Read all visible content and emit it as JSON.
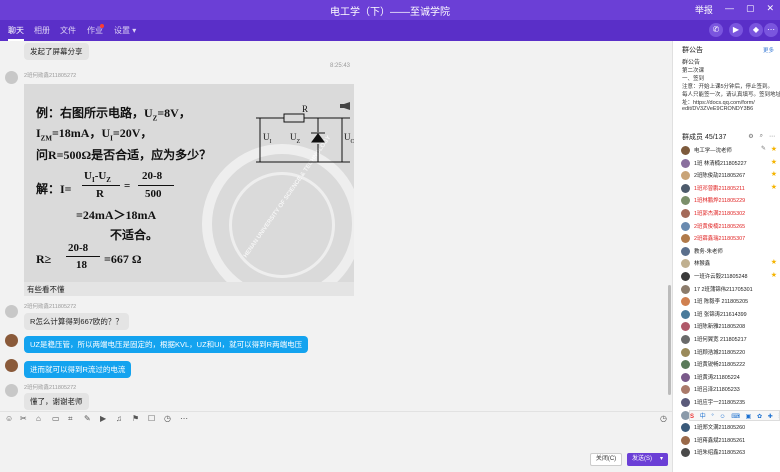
{
  "window": {
    "title": "电工学（下）——至诚学院",
    "controls": [
      "举报",
      "—",
      "▢",
      "✕"
    ]
  },
  "tabs": [
    {
      "label": "聊天",
      "active": true
    },
    {
      "label": "相册",
      "active": false
    },
    {
      "label": "文件",
      "active": false
    },
    {
      "label": "作业",
      "active": false,
      "badge": true
    },
    {
      "label": "设置",
      "active": false,
      "dropdown": true
    }
  ],
  "chat": {
    "screen_share": "发起了屏幕分享",
    "timestamp": "8:25:43",
    "sender1": "2班何勋鑫211805272",
    "slide": {
      "line1": "例：右图所示电路，U",
      "line1_sub": "Z",
      "line1_tail": "=8V，",
      "line2a": "I",
      "line2a_sub": "ZM",
      "line2b": "=18mA，U",
      "line2b_sub": "I",
      "line2c": "=20V，",
      "line3": "问R=500Ω是否合适，应为多少？",
      "sol_label": "解：I=",
      "frac_num": "U",
      "frac_num_sub1": "I",
      "frac_num_mid": "-U",
      "frac_num_sub2": "Z",
      "frac_den": "R",
      "frac2_num": "20-8",
      "frac2_den": "500",
      "result": "=24mA＞18mA",
      "unsuitable": "不适合。",
      "r_label": "R≥",
      "frac3_num": "20-8",
      "frac3_den": "18",
      "r_result": "=667 Ω",
      "circuit_r": "R",
      "circuit_ui": "U",
      "circuit_ui_sub": "I",
      "circuit_uz": "U",
      "circuit_uz_sub": "Z",
      "circuit_uo": "U",
      "circuit_uo_sub": "O",
      "watermark": "HENAN UNIVERSITY OF SCIENCE & TECHNOLOGY"
    },
    "caption": "有些看不懂",
    "sender2": "2班何勋鑫211805272",
    "msg2": "R怎么计算得到667欧的？？",
    "msg3": "UZ是稳压管，所以两端电压是固定的，根据KVL，UZ和UI，就可以得到R两端电压",
    "msg4": "进而就可以得到R流过的电流",
    "sender3": "2班何勋鑫211805272",
    "msg5": "懂了，谢谢老师"
  },
  "toolbar": {
    "icons": [
      "☺",
      "✂",
      "⌂",
      "▭",
      "⌗",
      "✎",
      "▶",
      "♫",
      "⚑",
      "☐",
      "◷",
      "⋯"
    ],
    "history": "◷"
  },
  "buttons": {
    "close": "关闭(C)",
    "send": "发送(S)",
    "send_dropdown": "▾"
  },
  "announcement": {
    "title": "群公告",
    "more": "更多",
    "lines": [
      "群公告",
      "第二次课",
      "一、签到",
      "注意：开始上课5分钟后，停止签到。",
      "每人只能签一次，请认真填写。签到地址",
      "址：https://docs.qq.com/form/",
      "edit/DV3ZVeE9CRONDY3B6"
    ]
  },
  "members": {
    "title": "群成员 45/137",
    "icons": [
      "⚙",
      "⌕",
      "⋯"
    ],
    "list": [
      {
        "name": "电工学—沈老师",
        "color": "#222",
        "star": true,
        "mgr": true,
        "av": "#7d5a3c"
      },
      {
        "name": "1班 林清楠211805227",
        "color": "#222",
        "star": true,
        "mgr": false,
        "av": "#8a6f9e"
      },
      {
        "name": "2班陈俊劼211805267",
        "color": "#222",
        "star": true,
        "mgr": false,
        "av": "#c9a478"
      },
      {
        "name": "1班邓曾鹏211805211",
        "color": "#e02020",
        "star": true,
        "mgr": false,
        "av": "#4d5b6c"
      },
      {
        "name": "1班林鹏烨211805229",
        "color": "#e02020",
        "star": false,
        "mgr": false,
        "av": "#7b8f6a"
      },
      {
        "name": "1班郭杰满211805302",
        "color": "#e02020",
        "star": false,
        "mgr": false,
        "av": "#a46a5a"
      },
      {
        "name": "2班黄俊楠211805265",
        "color": "#e02020",
        "star": false,
        "mgr": false,
        "av": "#6a8bb0"
      },
      {
        "name": "2班薛鑫瑞211805307",
        "color": "#e02020",
        "star": false,
        "mgr": false,
        "av": "#b07a4a"
      },
      {
        "name": "教务-朱老师",
        "color": "#222",
        "star": false,
        "mgr": false,
        "av": "#5b6f8c"
      },
      {
        "name": "林猴鑫",
        "color": "#222",
        "star": true,
        "mgr": false,
        "av": "#c0b090"
      },
      {
        "name": "一班许云毅211805248",
        "color": "#222",
        "star": true,
        "mgr": false,
        "av": "#3a3a3a"
      },
      {
        "name": "17 2班蒲锦伟211705301",
        "color": "#222",
        "star": false,
        "mgr": false,
        "av": "#8c7c6c"
      },
      {
        "name": "1班 陈毅李 211805205",
        "color": "#222",
        "star": false,
        "mgr": false,
        "av": "#d08050"
      },
      {
        "name": "1班 张锦涛211614399",
        "color": "#222",
        "star": false,
        "mgr": false,
        "av": "#4a7a9a"
      },
      {
        "name": "1班陈新雅211805208",
        "color": "#222",
        "star": false,
        "mgr": false,
        "av": "#b05a6a"
      },
      {
        "name": "1班何翼宽 211805217",
        "color": "#222",
        "star": false,
        "mgr": false,
        "av": "#6a6a6a"
      },
      {
        "name": "1班顾浩城211805220",
        "color": "#222",
        "star": false,
        "mgr": false,
        "av": "#9a8a5a"
      },
      {
        "name": "1班黄锐畅211805222",
        "color": "#222",
        "star": false,
        "mgr": false,
        "av": "#5a7a5a"
      },
      {
        "name": "1班黄涛211805224",
        "color": "#222",
        "star": false,
        "mgr": false,
        "av": "#7a5a8a"
      },
      {
        "name": "1班吕泽211805233",
        "color": "#222",
        "star": false,
        "mgr": false,
        "av": "#aa7a6a"
      },
      {
        "name": "1班应宇一211805235",
        "color": "#222",
        "star": false,
        "mgr": false,
        "av": "#5a5a7a"
      },
      {
        "name": "1班石润涛211805236",
        "color": "#222",
        "star": false,
        "mgr": false,
        "av": "#8a9aaa"
      },
      {
        "name": "1班郑文满211805260",
        "color": "#222",
        "star": false,
        "mgr": false,
        "av": "#3a5a7a"
      },
      {
        "name": "1班蒋鑫斌211805261",
        "color": "#222",
        "star": false,
        "mgr": false,
        "av": "#9a6a4a"
      },
      {
        "name": "1班朱绍鑫211805263",
        "color": "#222",
        "star": false,
        "mgr": false,
        "av": "#4a4a4a"
      }
    ]
  },
  "ime": {
    "brand": "S",
    "items": [
      "中",
      "°",
      "☺",
      "⌨",
      "▣",
      "✿",
      "✚",
      "☰"
    ]
  }
}
